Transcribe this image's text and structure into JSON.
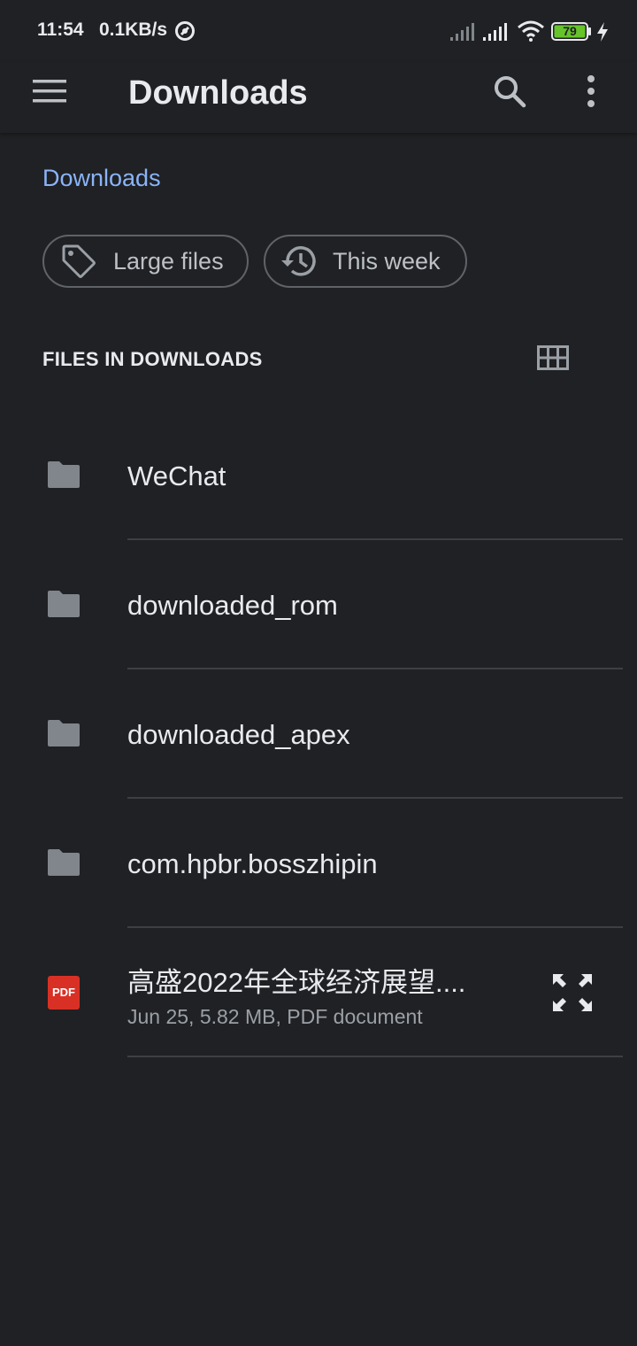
{
  "status_bar": {
    "time": "11:54",
    "net_speed": "0.1KB/s",
    "battery_level": "79",
    "icons": [
      "vpn-icon",
      "signal-weak-icon",
      "signal-icon",
      "wifi-icon",
      "battery-icon",
      "charging-icon"
    ]
  },
  "app_bar": {
    "title": "Downloads",
    "icons": [
      "menu-icon",
      "search-icon",
      "more-vert-icon"
    ]
  },
  "breadcrumb": "Downloads",
  "chips": [
    {
      "label": "Large files",
      "icon": "tag-icon"
    },
    {
      "label": "This week",
      "icon": "history-icon"
    }
  ],
  "section": {
    "title": "FILES IN DOWNLOADS",
    "view_toggle_icon": "grid-view-icon"
  },
  "files": [
    {
      "name": "WeChat",
      "type": "folder"
    },
    {
      "name": "downloaded_rom",
      "type": "folder"
    },
    {
      "name": "downloaded_apex",
      "type": "folder"
    },
    {
      "name": "com.hpbr.bosszhipin",
      "type": "folder"
    },
    {
      "name": "高盛2022年全球经济展望....",
      "type": "pdf",
      "icon_text": "PDF",
      "meta": "Jun 25, 5.82 MB, PDF document"
    }
  ],
  "colors": {
    "background": "#202124",
    "accent": "#8ab4f8",
    "text": "#e8eaed",
    "secondary_text": "#9aa0a6",
    "pdf": "#d93025",
    "battery": "#66c42a"
  }
}
